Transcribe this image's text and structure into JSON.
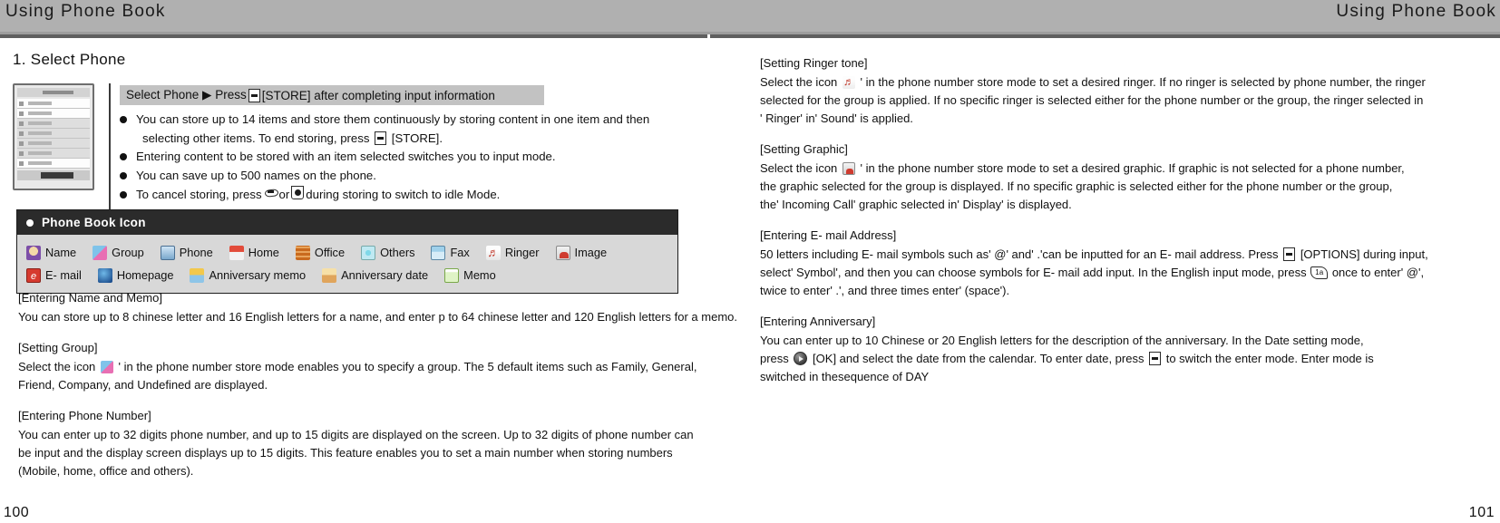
{
  "header": {
    "title_left": "Using Phone Book",
    "title_right": "Using Phone Book"
  },
  "left_column": {
    "section_heading": "1. Select Phone",
    "instruction_banner": {
      "pre": "Select Phone ▶ Press",
      "post": "[STORE] after completing  input information"
    },
    "bullets": [
      {
        "text": "You can store up to 14 items and store them continuously by storing content in one item and then",
        "continuation_pre": "selecting other items. To end storing, press",
        "continuation_post": "[STORE]."
      },
      {
        "text": "Entering content to be stored with an item selected switches you to input mode."
      },
      {
        "text": "You can save up to 500 names on the phone."
      },
      {
        "text_pre": "To cancel storing, press",
        "text_mid": "or",
        "text_post": "during storing to switch to idle Mode."
      }
    ],
    "icon_box": {
      "title": "Phone Book Icon",
      "row1": [
        {
          "label": "Name",
          "icon": "name-icon"
        },
        {
          "label": "Group",
          "icon": "group-icon"
        },
        {
          "label": "Phone",
          "icon": "phone-icon"
        },
        {
          "label": "Home",
          "icon": "home-icon"
        },
        {
          "label": "Office",
          "icon": "office-icon"
        },
        {
          "label": "Others",
          "icon": "others-icon"
        },
        {
          "label": "Fax",
          "icon": "fax-icon"
        },
        {
          "label": "Ringer",
          "icon": "ringer-icon"
        },
        {
          "label": "Image",
          "icon": "image-icon"
        }
      ],
      "row2": [
        {
          "label": "E- mail",
          "icon": "email-icon"
        },
        {
          "label": "Homepage",
          "icon": "homepage-icon"
        },
        {
          "label": "Anniversary memo",
          "icon": "anniversary-memo-icon"
        },
        {
          "label": "Anniversary date",
          "icon": "anniversary-date-icon"
        },
        {
          "label": "Memo",
          "icon": "memo-icon"
        }
      ]
    },
    "blocks": [
      {
        "heading": "[Entering Name and Memo]",
        "lines": [
          "You can store up to 8 chinese letter and 16 English letters for a name, and enter p to 64 chinese letter and 120 English letters for a memo."
        ]
      },
      {
        "heading": "[Setting Group]",
        "line1_pre": "Select the icon",
        "line1_post": "' in the phone number store mode enables you to specify a group. The 5 default items such as Family, General,",
        "lines": [
          "Friend, Company, and Undefined are displayed."
        ]
      },
      {
        "heading": "[Entering Phone Number]",
        "lines": [
          "You can enter up to 32 digits phone number, and up to 15 digits are displayed on the screen. Up to 32 digits of phone number can",
          "be input and the display screen displays up to 15 digits. This feature enables you to set a main number when storing numbers",
          "(Mobile, home, office and others)."
        ]
      }
    ],
    "page_number": "100"
  },
  "right_column": {
    "blocks": [
      {
        "heading": "[Setting Ringer tone]",
        "line1_pre": "Select the icon",
        "line1_post": "' in the phone number store mode to set a desired ringer. If no ringer is selected by phone number, the ringer",
        "lines": [
          "selected for the group is applied. If no specific ringer is selected either for the phone number or the group, the ringer selected in",
          "' Ringer' in' Sound' is applied."
        ]
      },
      {
        "heading": "[Setting Graphic]",
        "line1_pre": "Select the icon",
        "line1_post": "' in the phone number store mode to set a desired graphic. If graphic is not selected for a phone number,",
        "lines": [
          "the graphic selected for the group is displayed. If no specific graphic is selected either for the phone number or the group,",
          "the' Incoming Call' graphic selected in' Display' is displayed."
        ]
      },
      {
        "heading": "[Entering E- mail Address]",
        "line1_pre": "50 letters including E- mail symbols such as' @' and' .'can be inputted for an E- mail address. Press",
        "line1_post": "[OPTIONS] during input,",
        "line2_pre": "select' Symbol', and then you can choose symbols for E- mail add input. In the English input mode, press",
        "line2_post": "once to enter' @',",
        "lines": [
          "twice to enter' .', and three times enter' (space')."
        ]
      },
      {
        "heading": "[Entering Anniversary]",
        "lines_before": [
          "You can enter up to 10 Chinese or 20 English letters for the description of the anniversary. In the Date setting mode,"
        ],
        "line_mid_pre": "press",
        "line_mid_a": "[OK] and select the date from the calendar. To enter date, press",
        "line_mid_post": "to switch the enter mode. Enter mode is",
        "lines_after": [
          "switched in thesequence of DAY"
        ]
      }
    ],
    "page_number": "101"
  },
  "keys": {
    "store_key": "store-key-icon",
    "end_key": "end-key-icon",
    "power_key": "power-key-icon",
    "ok_key": "ok-key-icon",
    "star_key_label": "1a"
  },
  "colors": {
    "header_band": "#b0b0b0",
    "banner_gray": "#c2c2c2",
    "iconbox_header": "#2b2b2b",
    "iconbox_body": "#d8d8d8",
    "text": "#111111"
  }
}
